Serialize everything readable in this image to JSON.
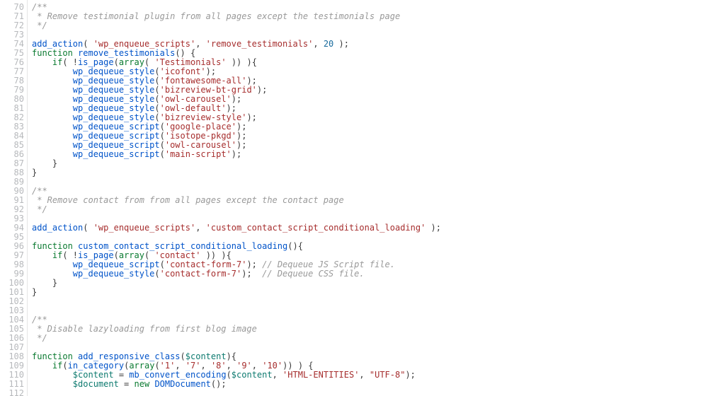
{
  "file": {
    "language": "php"
  },
  "gutter": {
    "start": 70,
    "end": 112
  },
  "code": {
    "lines": [
      [
        {
          "t": "/**",
          "c": "cm"
        }
      ],
      [
        {
          "t": " * Remove testimonial plugin from all pages except the testimonials page",
          "c": "cm"
        }
      ],
      [
        {
          "t": " */",
          "c": "cm"
        }
      ],
      [],
      [
        {
          "t": "add_action",
          "c": "fn"
        },
        {
          "t": "( ",
          "c": "op"
        },
        {
          "t": "'wp_enqueue_scripts'",
          "c": "st"
        },
        {
          "t": ", ",
          "c": "op"
        },
        {
          "t": "'remove_testimonials'",
          "c": "st"
        },
        {
          "t": ", ",
          "c": "op"
        },
        {
          "t": "20",
          "c": "nu"
        },
        {
          "t": " );",
          "c": "op"
        }
      ],
      [
        {
          "t": "function",
          "c": "kw"
        },
        {
          "t": " ",
          "c": "op"
        },
        {
          "t": "remove_testimonials",
          "c": "fn"
        },
        {
          "t": "() {",
          "c": "op"
        }
      ],
      [
        {
          "t": "    ",
          "c": "op"
        },
        {
          "t": "if",
          "c": "kw"
        },
        {
          "t": "( !",
          "c": "op"
        },
        {
          "t": "is_page",
          "c": "fn"
        },
        {
          "t": "(",
          "c": "op"
        },
        {
          "t": "array",
          "c": "kw"
        },
        {
          "t": "( ",
          "c": "op"
        },
        {
          "t": "'Testimonials'",
          "c": "st"
        },
        {
          "t": " )) ){",
          "c": "op"
        }
      ],
      [
        {
          "t": "        ",
          "c": "op"
        },
        {
          "t": "wp_dequeue_style",
          "c": "fn"
        },
        {
          "t": "(",
          "c": "op"
        },
        {
          "t": "'icofont'",
          "c": "st"
        },
        {
          "t": ");",
          "c": "op"
        }
      ],
      [
        {
          "t": "        ",
          "c": "op"
        },
        {
          "t": "wp_dequeue_style",
          "c": "fn"
        },
        {
          "t": "(",
          "c": "op"
        },
        {
          "t": "'fontawesome-all'",
          "c": "st"
        },
        {
          "t": ");",
          "c": "op"
        }
      ],
      [
        {
          "t": "        ",
          "c": "op"
        },
        {
          "t": "wp_dequeue_style",
          "c": "fn"
        },
        {
          "t": "(",
          "c": "op"
        },
        {
          "t": "'bizreview-bt-grid'",
          "c": "st"
        },
        {
          "t": ");",
          "c": "op"
        }
      ],
      [
        {
          "t": "        ",
          "c": "op"
        },
        {
          "t": "wp_dequeue_style",
          "c": "fn"
        },
        {
          "t": "(",
          "c": "op"
        },
        {
          "t": "'owl-carousel'",
          "c": "st"
        },
        {
          "t": ");",
          "c": "op"
        }
      ],
      [
        {
          "t": "        ",
          "c": "op"
        },
        {
          "t": "wp_dequeue_style",
          "c": "fn"
        },
        {
          "t": "(",
          "c": "op"
        },
        {
          "t": "'owl-default'",
          "c": "st"
        },
        {
          "t": ");",
          "c": "op"
        }
      ],
      [
        {
          "t": "        ",
          "c": "op"
        },
        {
          "t": "wp_dequeue_style",
          "c": "fn"
        },
        {
          "t": "(",
          "c": "op"
        },
        {
          "t": "'bizreview-style'",
          "c": "st"
        },
        {
          "t": ");",
          "c": "op"
        }
      ],
      [
        {
          "t": "        ",
          "c": "op"
        },
        {
          "t": "wp_dequeue_script",
          "c": "fn"
        },
        {
          "t": "(",
          "c": "op"
        },
        {
          "t": "'google-place'",
          "c": "st"
        },
        {
          "t": ");",
          "c": "op"
        }
      ],
      [
        {
          "t": "        ",
          "c": "op"
        },
        {
          "t": "wp_dequeue_script",
          "c": "fn"
        },
        {
          "t": "(",
          "c": "op"
        },
        {
          "t": "'isotope-pkgd'",
          "c": "st"
        },
        {
          "t": ");",
          "c": "op"
        }
      ],
      [
        {
          "t": "        ",
          "c": "op"
        },
        {
          "t": "wp_dequeue_script",
          "c": "fn"
        },
        {
          "t": "(",
          "c": "op"
        },
        {
          "t": "'owl-carousel'",
          "c": "st"
        },
        {
          "t": ");",
          "c": "op"
        }
      ],
      [
        {
          "t": "        ",
          "c": "op"
        },
        {
          "t": "wp_dequeue_script",
          "c": "fn"
        },
        {
          "t": "(",
          "c": "op"
        },
        {
          "t": "'main-script'",
          "c": "st"
        },
        {
          "t": ");",
          "c": "op"
        }
      ],
      [
        {
          "t": "    }",
          "c": "op"
        }
      ],
      [
        {
          "t": "}",
          "c": "op"
        }
      ],
      [],
      [
        {
          "t": "/**",
          "c": "cm"
        }
      ],
      [
        {
          "t": " * Remove contact from from all pages except the contact page",
          "c": "cm"
        }
      ],
      [
        {
          "t": " */",
          "c": "cm"
        }
      ],
      [],
      [
        {
          "t": "add_action",
          "c": "fn"
        },
        {
          "t": "( ",
          "c": "op"
        },
        {
          "t": "'wp_enqueue_scripts'",
          "c": "st"
        },
        {
          "t": ", ",
          "c": "op"
        },
        {
          "t": "'custom_contact_script_conditional_loading'",
          "c": "st"
        },
        {
          "t": " );",
          "c": "op"
        }
      ],
      [],
      [
        {
          "t": "function",
          "c": "kw"
        },
        {
          "t": " ",
          "c": "op"
        },
        {
          "t": "custom_contact_script_conditional_loading",
          "c": "fn"
        },
        {
          "t": "(){",
          "c": "op"
        }
      ],
      [
        {
          "t": "    ",
          "c": "op"
        },
        {
          "t": "if",
          "c": "kw"
        },
        {
          "t": "( !",
          "c": "op"
        },
        {
          "t": "is_page",
          "c": "fn"
        },
        {
          "t": "(",
          "c": "op"
        },
        {
          "t": "array",
          "c": "kw"
        },
        {
          "t": "( ",
          "c": "op"
        },
        {
          "t": "'contact'",
          "c": "st"
        },
        {
          "t": " )) ){",
          "c": "op"
        }
      ],
      [
        {
          "t": "        ",
          "c": "op"
        },
        {
          "t": "wp_dequeue_script",
          "c": "fn"
        },
        {
          "t": "(",
          "c": "op"
        },
        {
          "t": "'contact-form-7'",
          "c": "st"
        },
        {
          "t": "); ",
          "c": "op"
        },
        {
          "t": "// Dequeue JS Script file.",
          "c": "cm"
        }
      ],
      [
        {
          "t": "        ",
          "c": "op"
        },
        {
          "t": "wp_dequeue_style",
          "c": "fn"
        },
        {
          "t": "(",
          "c": "op"
        },
        {
          "t": "'contact-form-7'",
          "c": "st"
        },
        {
          "t": ");  ",
          "c": "op"
        },
        {
          "t": "// Dequeue CSS file.",
          "c": "cm"
        }
      ],
      [
        {
          "t": "    }",
          "c": "op"
        }
      ],
      [
        {
          "t": "}",
          "c": "op"
        }
      ],
      [],
      [],
      [
        {
          "t": "/**",
          "c": "cm"
        }
      ],
      [
        {
          "t": " * Disable lazyloading from first blog image",
          "c": "cm"
        }
      ],
      [
        {
          "t": " */",
          "c": "cm"
        }
      ],
      [],
      [
        {
          "t": "function",
          "c": "kw"
        },
        {
          "t": " ",
          "c": "op"
        },
        {
          "t": "add_responsive_class",
          "c": "fn"
        },
        {
          "t": "(",
          "c": "op"
        },
        {
          "t": "$content",
          "c": "vr"
        },
        {
          "t": "){",
          "c": "op"
        }
      ],
      [
        {
          "t": "    ",
          "c": "op"
        },
        {
          "t": "if",
          "c": "kw"
        },
        {
          "t": "(",
          "c": "op"
        },
        {
          "t": "in_category",
          "c": "fn"
        },
        {
          "t": "(",
          "c": "op"
        },
        {
          "t": "array",
          "c": "kw"
        },
        {
          "t": "(",
          "c": "op"
        },
        {
          "t": "'1'",
          "c": "st"
        },
        {
          "t": ", ",
          "c": "op"
        },
        {
          "t": "'7'",
          "c": "st"
        },
        {
          "t": ", ",
          "c": "op"
        },
        {
          "t": "'8'",
          "c": "st"
        },
        {
          "t": ", ",
          "c": "op"
        },
        {
          "t": "'9'",
          "c": "st"
        },
        {
          "t": ", ",
          "c": "op"
        },
        {
          "t": "'10'",
          "c": "st"
        },
        {
          "t": ")) ) {",
          "c": "op"
        }
      ],
      [
        {
          "t": "        ",
          "c": "op"
        },
        {
          "t": "$content",
          "c": "vr"
        },
        {
          "t": " = ",
          "c": "op"
        },
        {
          "t": "mb_convert_encoding",
          "c": "fn"
        },
        {
          "t": "(",
          "c": "op"
        },
        {
          "t": "$content",
          "c": "vr"
        },
        {
          "t": ", ",
          "c": "op"
        },
        {
          "t": "'HTML-ENTITIES'",
          "c": "st"
        },
        {
          "t": ", ",
          "c": "op"
        },
        {
          "t": "\"UTF-8\"",
          "c": "st"
        },
        {
          "t": ");",
          "c": "op"
        }
      ],
      [
        {
          "t": "        ",
          "c": "op"
        },
        {
          "t": "$document",
          "c": "vr"
        },
        {
          "t": " = ",
          "c": "op"
        },
        {
          "t": "new",
          "c": "kw"
        },
        {
          "t": " ",
          "c": "op"
        },
        {
          "t": "DOMDocument",
          "c": "fn"
        },
        {
          "t": "();",
          "c": "op"
        }
      ]
    ]
  }
}
